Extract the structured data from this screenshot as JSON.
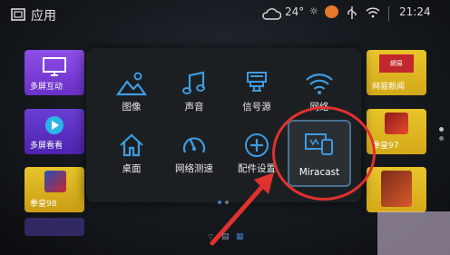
{
  "header": {
    "title": "应用",
    "temperature": "24°",
    "time": "21:24"
  },
  "tiles_left": [
    {
      "label": "多屏互动",
      "color": "#7b3fd6"
    },
    {
      "label": "多屏看看",
      "color": "#5d2fc0"
    },
    {
      "label": "拳皇98",
      "color": "#d9b21a"
    }
  ],
  "tiles_right": [
    {
      "label": "网易新闻",
      "badge": "網易",
      "color": "#c2272d"
    },
    {
      "label": "拳皇97",
      "color": "#d9b21a"
    },
    {
      "label": "",
      "color": "#d9b21a"
    }
  ],
  "menu": {
    "items": [
      {
        "label": "图像",
        "icon": "image-icon"
      },
      {
        "label": "声音",
        "icon": "music-note-icon"
      },
      {
        "label": "信号源",
        "icon": "signal-source-icon"
      },
      {
        "label": "网络",
        "icon": "wifi-icon"
      },
      {
        "label": "桌面",
        "icon": "home-icon"
      },
      {
        "label": "网络测速",
        "icon": "speed-gauge-icon"
      },
      {
        "label": "配件设置",
        "icon": "plus-icon"
      },
      {
        "label": "Miracast",
        "icon": "miracast-icon"
      }
    ],
    "page_indicator": {
      "current": 1,
      "total": 2
    }
  },
  "colors": {
    "highlight": "#e0312e",
    "accent": "#3d7cc9"
  }
}
